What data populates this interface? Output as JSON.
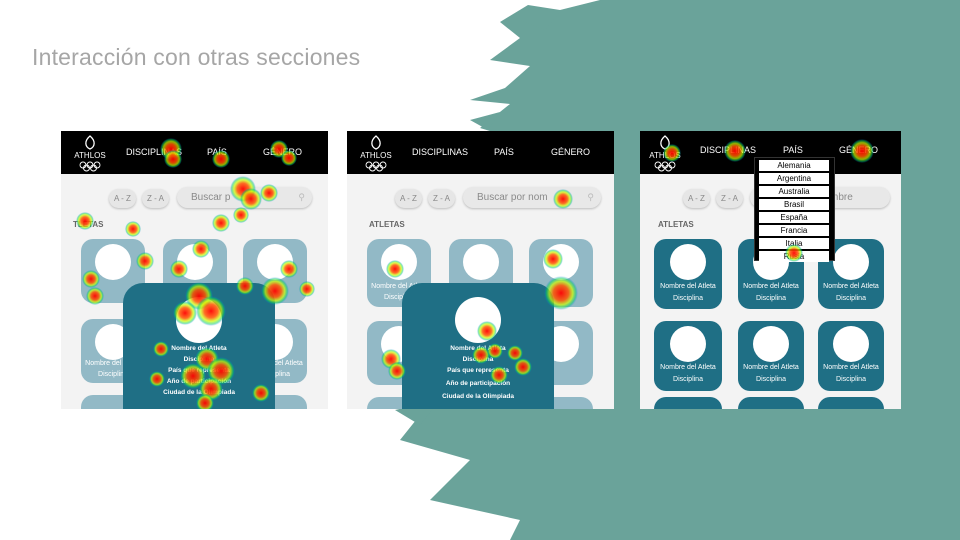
{
  "slide": {
    "title": "Interacción con otras secciones"
  },
  "colors": {
    "brush": "#6aa39a",
    "card_light": "#92b9c6",
    "card_dark": "#1f6f85",
    "topbar": "#000000"
  },
  "app": {
    "logo_text": "ATHLOS",
    "nav": {
      "disciplinas": "DISCIPLINAS",
      "pais": "PAÍS",
      "genero": "GÉNERO"
    },
    "sort": {
      "az": "A - Z",
      "za": "Z - A"
    },
    "search_placeholder": "Buscar por nombre",
    "section_label": "ATLETAS",
    "card": {
      "name": "Nombre del Atleta",
      "discipline": "Disciplina"
    },
    "detail": {
      "name": "Nombre del Atleta",
      "discipline": "Disciplina",
      "country": "País que representa",
      "year": "Año de participación",
      "city": "Ciudad de la Olimpiada"
    }
  },
  "screens": {
    "s1": {
      "nav_disciplinas": "DISCIPLINAS",
      "nav_pais": "PAÍS",
      "nav_genero": "GÉNERO",
      "search": "Buscar p",
      "section": "TLETAS"
    },
    "s2": {
      "nav_disciplinas": "DISCIPLINAS",
      "nav_pais": "PAÍS",
      "nav_genero": "GÉNERO",
      "search": "Buscar por nom",
      "section": "ATLETAS"
    },
    "s3": {
      "nav_disciplinas": "DISCIPLINAS",
      "nav_pais": "PAÍS",
      "nav_genero": "GÉNERO",
      "search": "mbre",
      "section": "ATLETAS"
    }
  },
  "country_dropdown": [
    "Alemania",
    "Argentina",
    "Australia",
    "Brasil",
    "España",
    "Francia",
    "Italia",
    "Rusia"
  ]
}
